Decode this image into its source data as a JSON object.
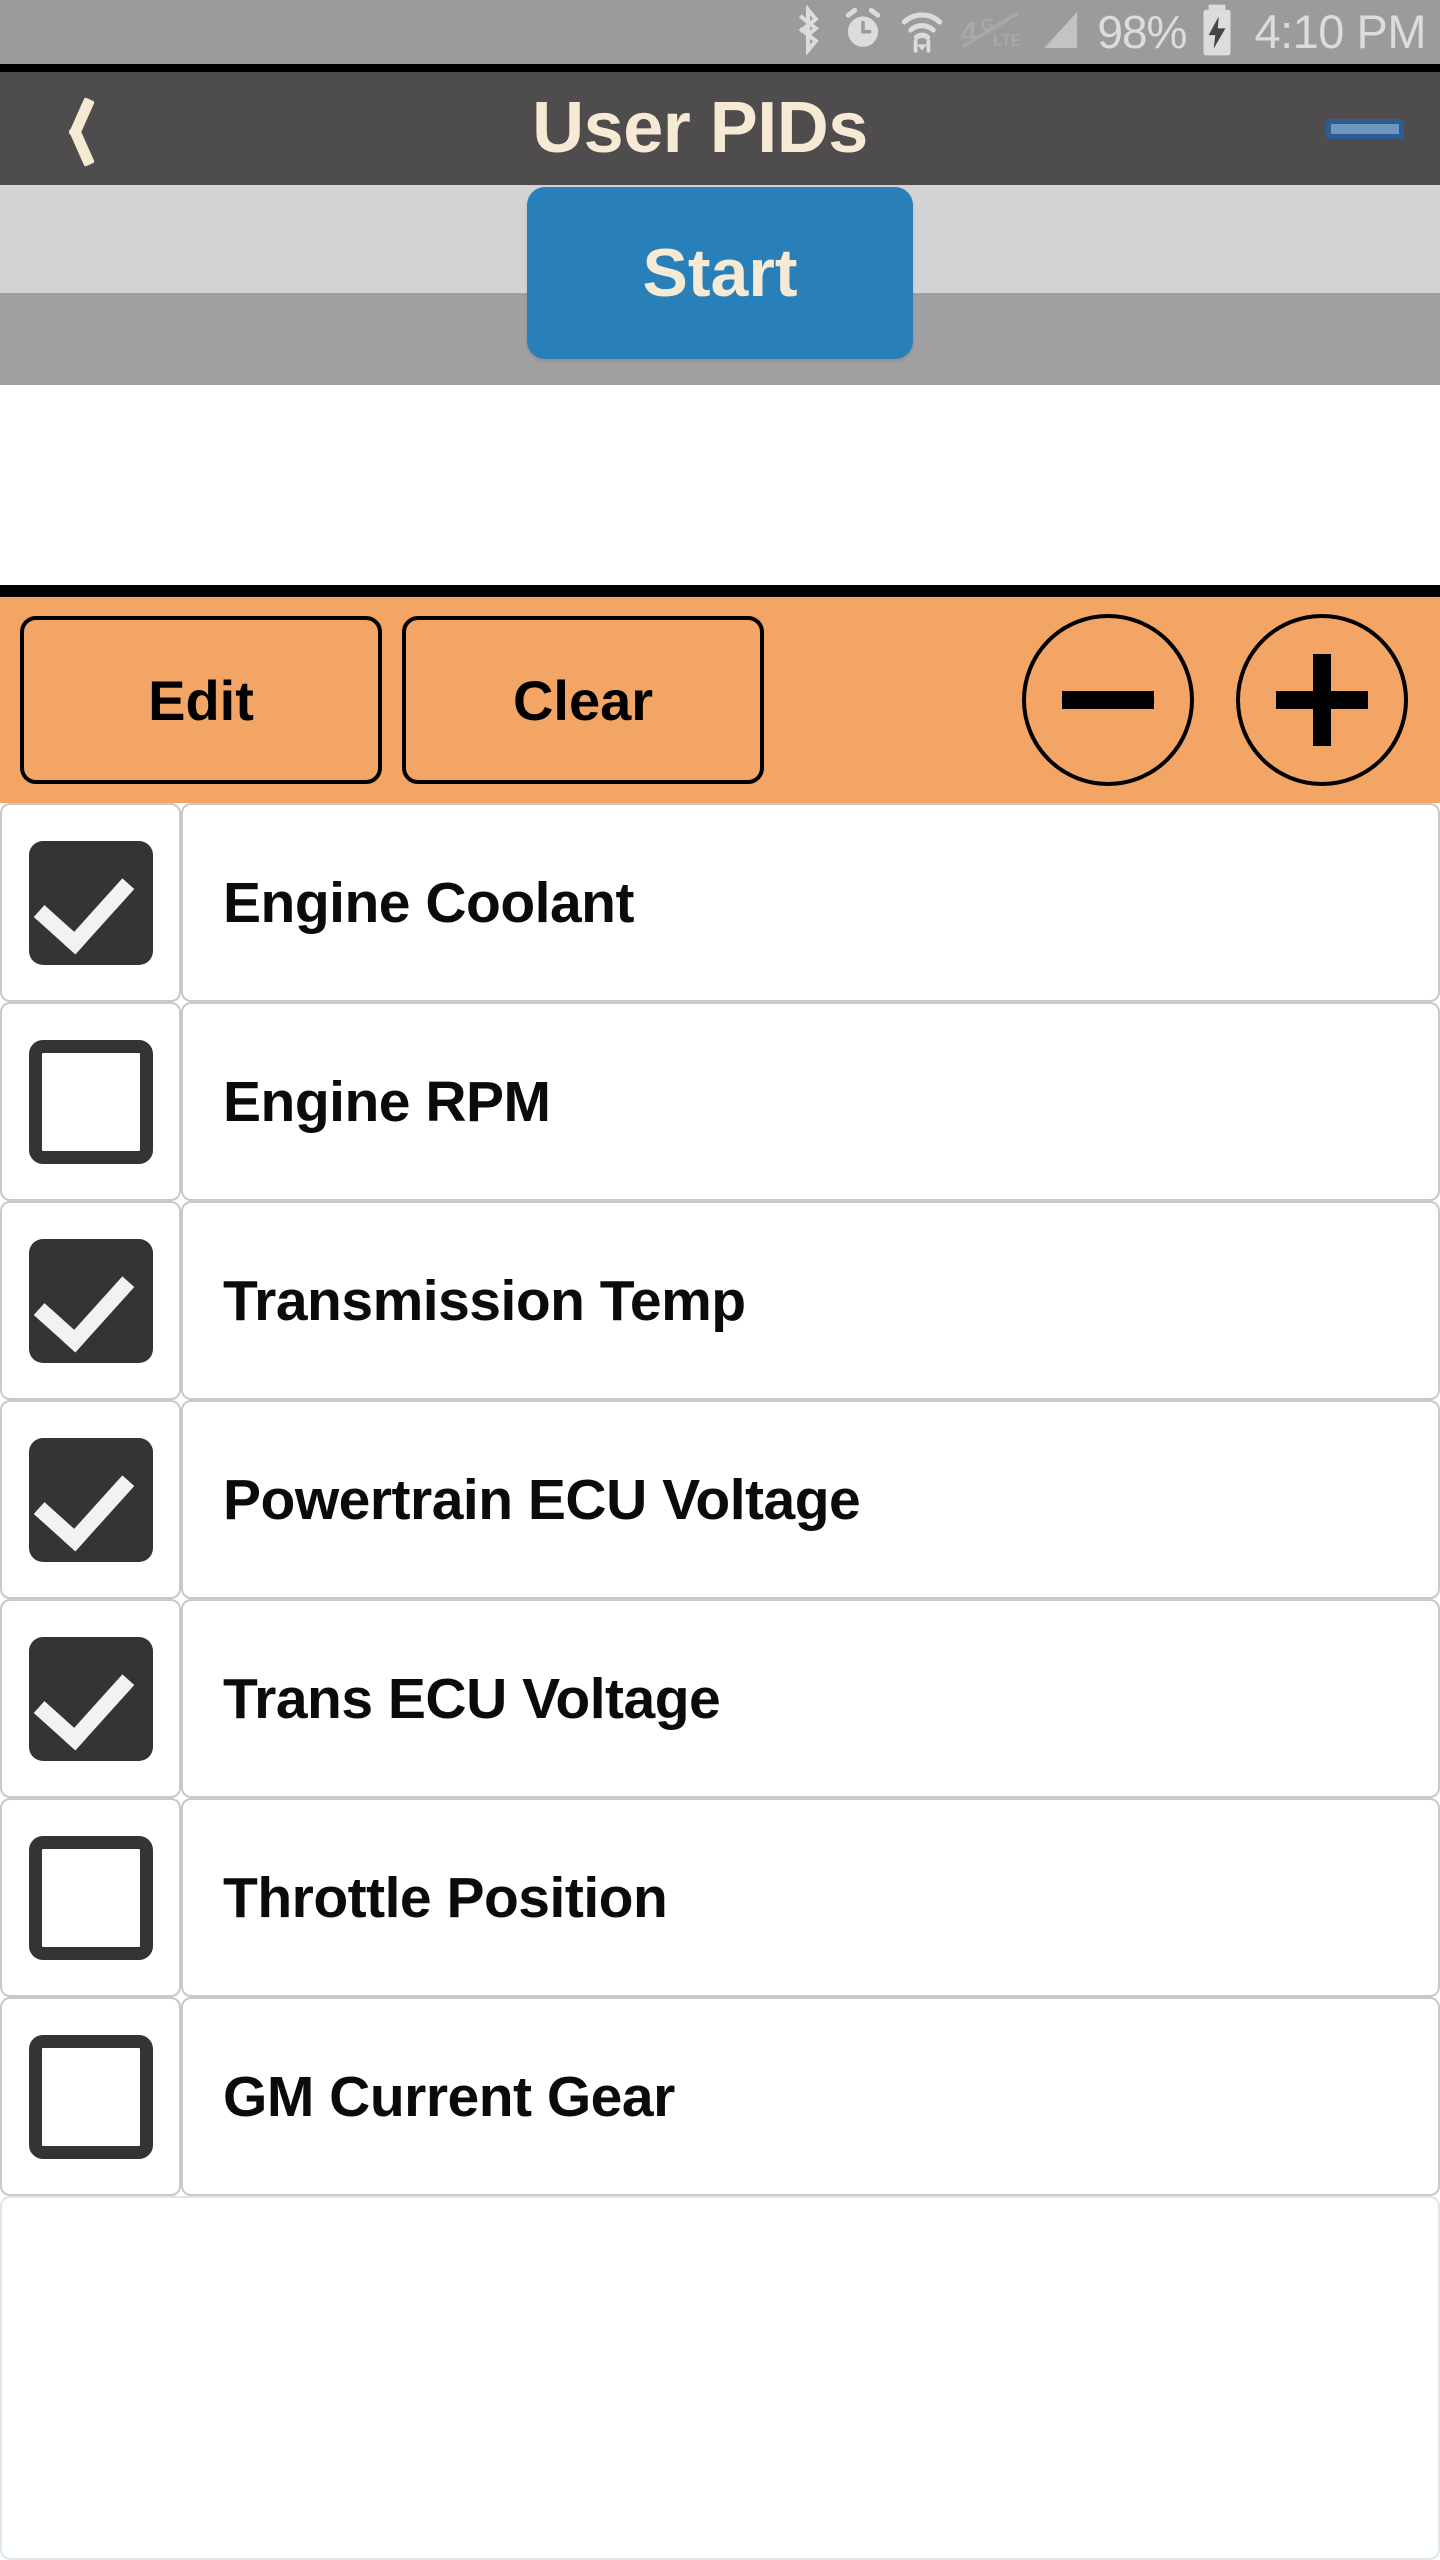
{
  "statusbar": {
    "icons": [
      "bluetooth-icon",
      "alarm-clock-icon",
      "wifi-icon",
      "4g-lte-off-icon",
      "cell-signal-icon",
      "battery-charging-icon"
    ],
    "battery_percent": "98%",
    "time": "4:10 PM"
  },
  "titlebar": {
    "back_label": "back-chevron",
    "title": "User PIDs",
    "right_indicator": "dash-indicator"
  },
  "start_bar": {
    "start_label": "Start"
  },
  "toolbar": {
    "edit_label": "Edit",
    "clear_label": "Clear",
    "minus_label": "minus-icon",
    "plus_label": "plus-icon"
  },
  "pid_list": [
    {
      "label": "Engine Coolant",
      "checked": true
    },
    {
      "label": "Engine RPM",
      "checked": false
    },
    {
      "label": "Transmission Temp",
      "checked": true
    },
    {
      "label": "Powertrain ECU Voltage",
      "checked": true
    },
    {
      "label": "Trans ECU Voltage",
      "checked": true
    },
    {
      "label": "Throttle Position",
      "checked": false
    },
    {
      "label": "GM Current Gear",
      "checked": false
    }
  ],
  "colors": {
    "statusbar_bg": "#9b9b9e",
    "titlebar_bg": "#4e4c4c",
    "title_text": "#f7ead4",
    "start_button": "#2980b9",
    "toolbar_orange": "#f2a565",
    "checkbox_dark": "#343434",
    "row_border": "#c9c9c9",
    "light_strip": "#d3d3d6",
    "gray_strip": "#a0a0a3"
  }
}
